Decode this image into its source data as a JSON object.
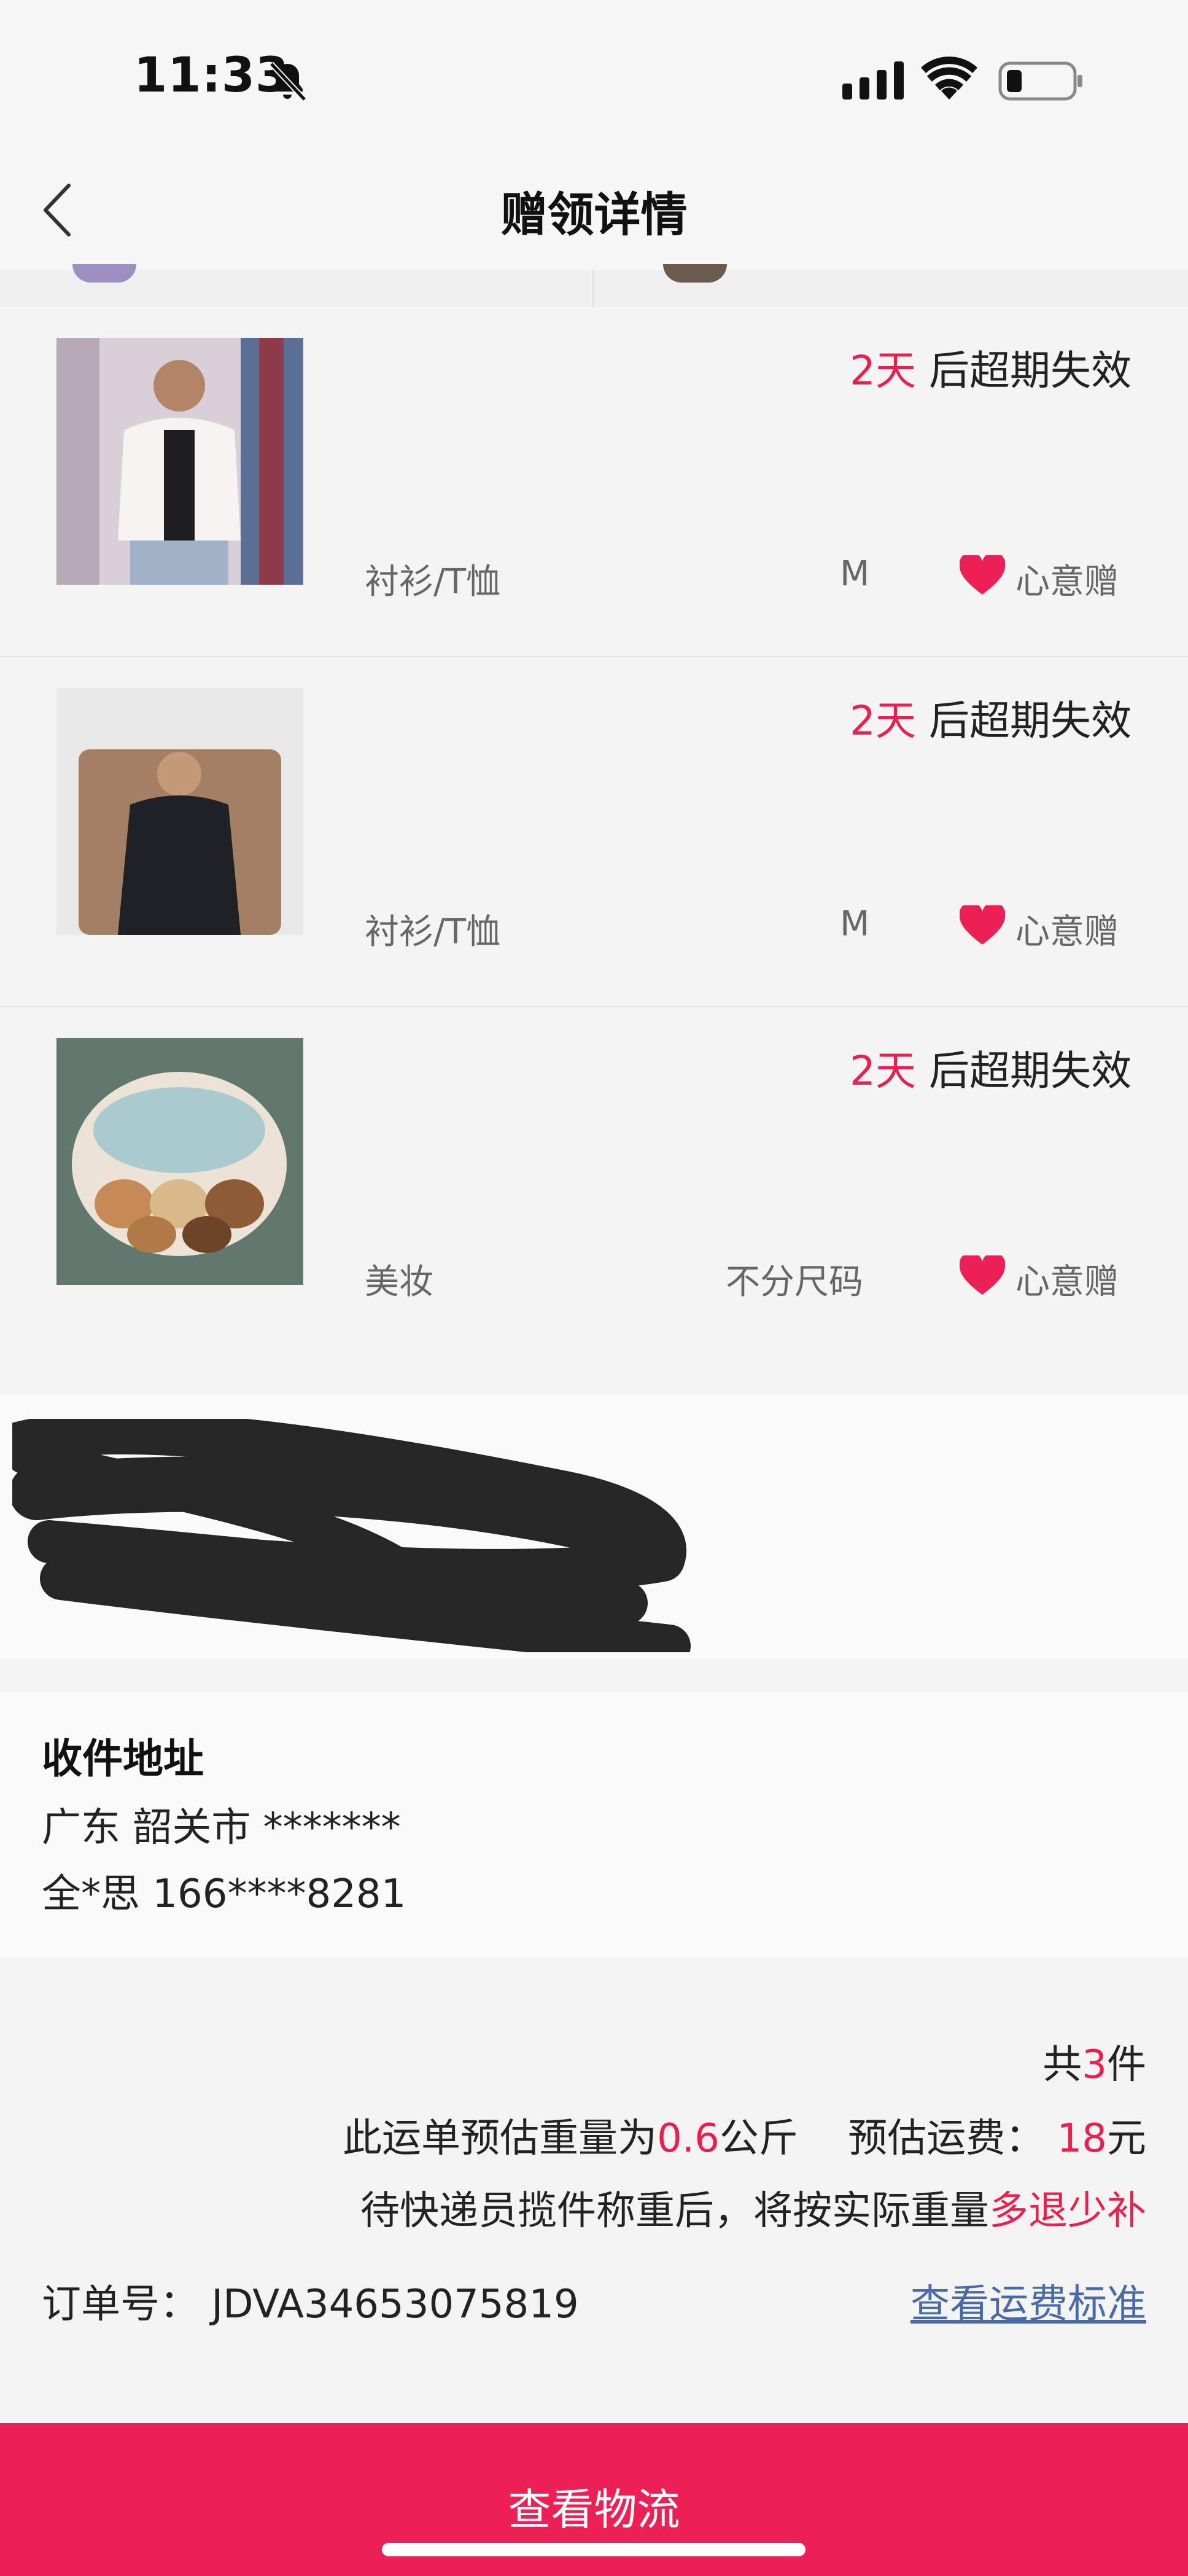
{
  "status_bar": {
    "time": "11:33",
    "icons": [
      "bell-slash-icon",
      "cellular-icon",
      "wifi-icon",
      "battery-icon"
    ]
  },
  "nav": {
    "title": "赠领详情",
    "back_icon": "chevron-left-icon"
  },
  "items": [
    {
      "expire_days": "2天",
      "expire_suffix": " 后超期失效",
      "category": "衬衫/T恤",
      "size": "M",
      "gift_label": "心意赠"
    },
    {
      "expire_days": "2天",
      "expire_suffix": " 后超期失效",
      "category": "衬衫/T恤",
      "size": "M",
      "gift_label": "心意赠"
    },
    {
      "expire_days": "2天",
      "expire_suffix": " 后超期失效",
      "category": "美妆",
      "size": "不分尺码",
      "gift_label": "心意赠"
    }
  ],
  "address": {
    "label": "收件地址",
    "region": "广东 韶关市 *******",
    "contact": "全*思 166****8281"
  },
  "summary": {
    "count_prefix": "共",
    "count": "3",
    "count_suffix": "件",
    "weight_prefix": "此运单预估重量为",
    "weight": "0.6",
    "weight_unit": "公斤",
    "fee_prefix": "预估运费：",
    "fee": "18",
    "fee_unit": "元",
    "note_prefix": "待快递员揽件称重后，将按实际重量",
    "note_highlight": "多退少补",
    "order_label": "订单号：",
    "order_no": "JDVA34653075819",
    "fee_standard_link": "查看运费标准"
  },
  "bottom": {
    "button_label": "查看物流"
  },
  "colors": {
    "accent": "#e8204f",
    "button": "#ec2054",
    "link": "#4a6aa6"
  }
}
